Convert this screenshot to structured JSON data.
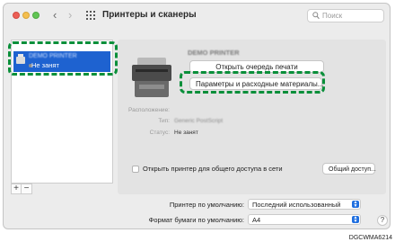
{
  "window": {
    "title": "Принтеры и сканеры",
    "nav_back": "‹",
    "nav_forward": "›",
    "search_placeholder": "Поиск"
  },
  "printer_list": {
    "items": [
      {
        "name": "DEMO PRINTER",
        "status": "Не занят",
        "selected": true
      }
    ],
    "add_label": "+",
    "remove_label": "−"
  },
  "detail": {
    "printer_name": "DEMO PRINTER",
    "open_queue_label": "Открыть очередь печати",
    "options_label": "Параметры и расходные материалы...",
    "location_label": "Расположение:",
    "location_value": "",
    "kind_label": "Тип:",
    "kind_value": "Generic PostScript",
    "status_label": "Статус:",
    "status_value": "Не занят",
    "share_label": "Открыть принтер для общего доступа в сети",
    "sharing_button_label": "Общий доступ..."
  },
  "defaults": {
    "printer_label": "Принтер по умолчанию:",
    "printer_value": "Последний использованный",
    "paper_label": "Формат бумаги по умолчанию:",
    "paper_value": "A4"
  },
  "help_label": "?",
  "caption": "DGCWMA6214",
  "colors": {
    "highlight": "#0a8f3a",
    "selection": "#1e62d0",
    "popup_arrow": "#1f6fe0"
  }
}
